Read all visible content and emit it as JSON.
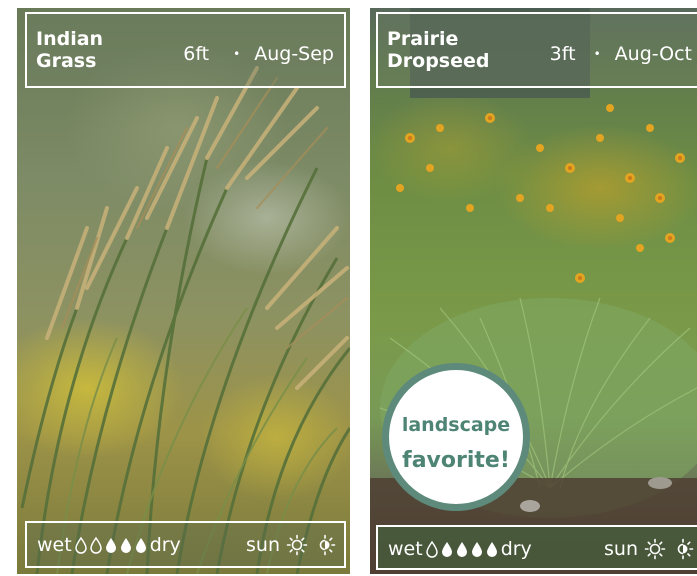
{
  "cards": [
    {
      "name_line1": "Indian",
      "name_line2": "Grass",
      "height": "6ft",
      "separator": "•",
      "bloom": "Aug-Sep",
      "wet_label": "wet",
      "dry_label": "dry",
      "sun_label": "sun",
      "moisture_drops": [
        "outline",
        "outline",
        "filled",
        "filled",
        "filled"
      ],
      "sun_icons": [
        "full-sun-icon",
        "part-sun-icon"
      ]
    },
    {
      "name_line1": "Prairie",
      "name_line2": "Dropseed",
      "height": "3ft",
      "separator": "•",
      "bloom": "Aug-Oct",
      "wet_label": "wet",
      "dry_label": "dry",
      "sun_label": "sun",
      "moisture_drops": [
        "outline",
        "filled",
        "filled",
        "filled",
        "filled"
      ],
      "sun_icons": [
        "full-sun-icon",
        "part-sun-icon"
      ],
      "badge_line1": "landscape",
      "badge_line2": "favorite!"
    }
  ],
  "colors": {
    "badge_ring": "#5d8a7b",
    "badge_text": "#4e8474",
    "overlay_text": "#ffffff"
  }
}
